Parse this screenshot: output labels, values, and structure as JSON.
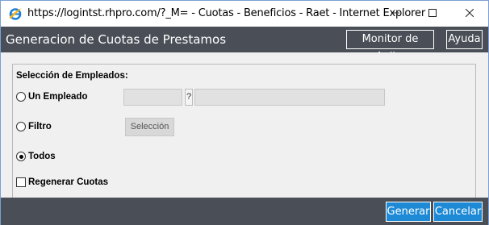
{
  "window": {
    "title": "https://logintst.rhpro.com/?_M= - Cuotas - Beneficios - Raet - Internet Explorer"
  },
  "header": {
    "title": "Generacion de Cuotas de Prestamos",
    "monitor_label": "Monitor de Aplic.",
    "help_label": "Ayuda"
  },
  "form": {
    "legend": "Selección de Empleados:",
    "options": {
      "un_empleado": "Un Empleado",
      "filtro": "Filtro",
      "todos": "Todos"
    },
    "selected_option": "todos",
    "employee_lookup_label": "?",
    "selection_button": "Selección",
    "regenerate_label": "Regenerar Cuotas",
    "regenerate_checked": false
  },
  "footer": {
    "generate_label": "Generar",
    "cancel_label": "Cancelar"
  },
  "colors": {
    "header_bg": "#4a4f57",
    "button_blue": "#1e8ad6",
    "body_bg": "#f0f0f0"
  },
  "icons": [
    "internet-explorer-icon",
    "minimize-icon",
    "maximize-icon",
    "close-icon"
  ]
}
